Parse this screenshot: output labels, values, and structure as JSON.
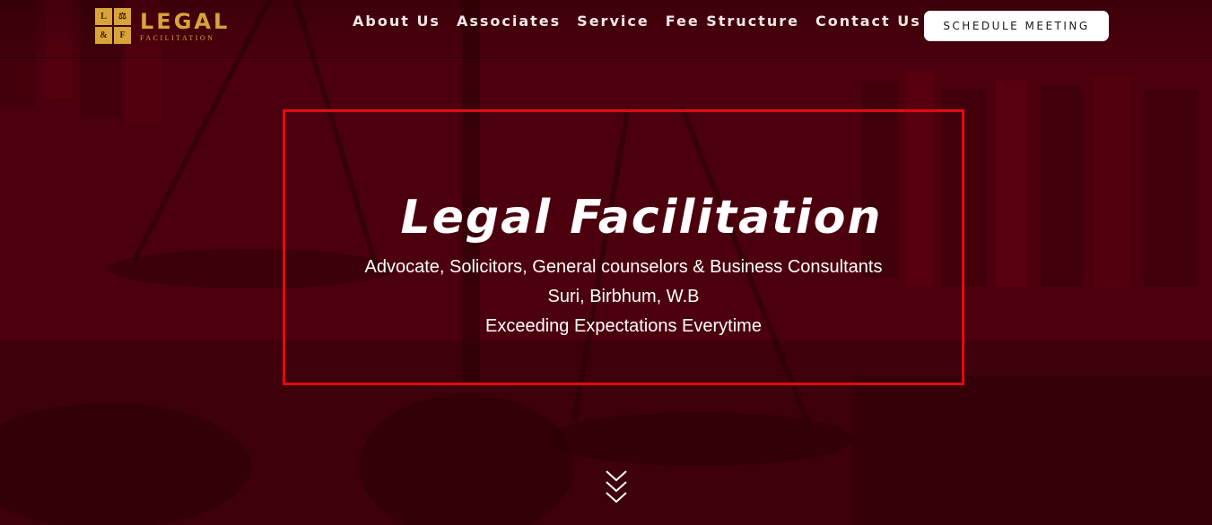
{
  "brand": {
    "logo_letters": [
      "L",
      "⚖",
      "&",
      "F"
    ],
    "title": "LEGAL",
    "subtitle": "FACILITATION"
  },
  "nav": {
    "items": [
      "About Us",
      "Associates",
      "Service",
      "Fee Structure",
      "Contact Us"
    ],
    "cta_label": "SCHEDULE MEETING"
  },
  "hero": {
    "title": "Legal Facilitation",
    "line1": "Advocate, Solicitors, General counselors & Business Consultants",
    "line2": "Suri, Birbhum, W.B",
    "line3": "Exceeding Expectations Everytime"
  },
  "colors": {
    "accent_gold": "#d9a33a",
    "box_border": "#e00a14",
    "background": "#4a000c"
  },
  "icons": {
    "scroll": "chevron-double-down-icon"
  }
}
